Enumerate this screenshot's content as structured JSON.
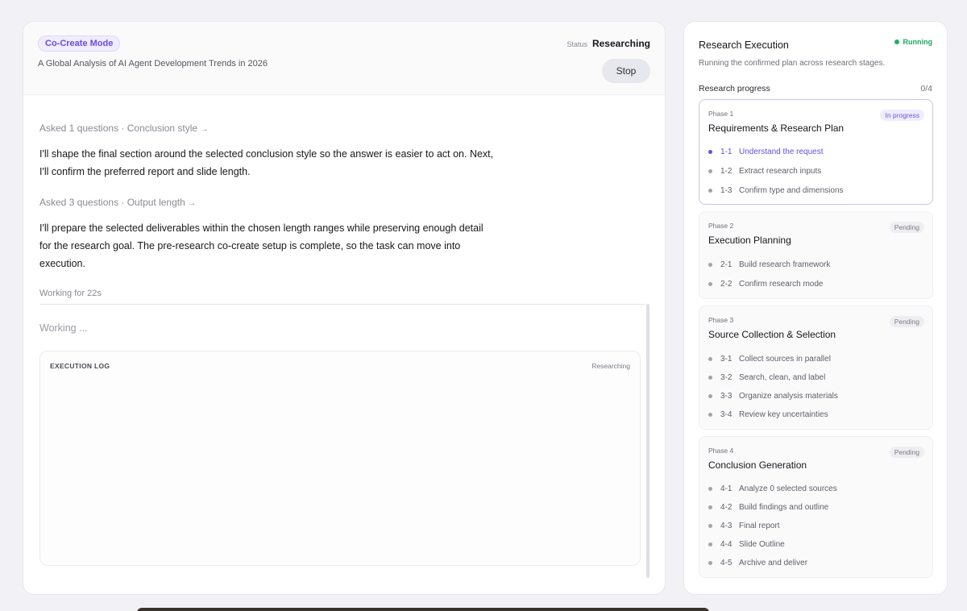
{
  "left": {
    "mode_badge": "Co-Create Mode",
    "task_title": "A Global Analysis of AI Agent Development Trends in 2026",
    "status_label": "Status",
    "status_value": "Researching",
    "stop_label": "Stop",
    "messages": [
      {
        "meta": "Asked 1 questions · Conclusion style",
        "arrow": "→",
        "lines": [
          "I'll shape the final section around the selected conclusion style so the answer is easier to act on. Next,",
          "I'll confirm the preferred report and slide length."
        ]
      },
      {
        "meta": "Asked 3 questions · Output length",
        "arrow": "→",
        "lines": [
          "I'll prepare the selected deliverables within the chosen length ranges while preserving enough detail",
          "for the research goal. The pre-research co-create setup is complete, so the task can move into",
          "execution."
        ]
      }
    ],
    "working_time": "Working for 22s",
    "working_text": "Working ...",
    "log_title": "EXECUTION LOG",
    "log_status": "Researching"
  },
  "right": {
    "title": "Research Execution",
    "running_label": "Running",
    "subtitle": "Running the confirmed plan across research stages.",
    "progress_label": "Research progress",
    "progress_count": "0/4",
    "phases": [
      {
        "num": "Phase 1",
        "name": "Requirements & Research Plan",
        "badge": "In progress",
        "steps": [
          {
            "id": "1-1",
            "label": "Understand the request"
          },
          {
            "id": "1-2",
            "label": "Extract research inputs"
          },
          {
            "id": "1-3",
            "label": "Confirm type and dimensions"
          }
        ]
      },
      {
        "num": "Phase 2",
        "name": "Execution Planning",
        "badge": "Pending",
        "steps": [
          {
            "id": "2-1",
            "label": "Build research framework"
          },
          {
            "id": "2-2",
            "label": "Confirm research mode"
          }
        ]
      },
      {
        "num": "Phase 3",
        "name": "Source Collection & Selection",
        "badge": "Pending",
        "steps": [
          {
            "id": "3-1",
            "label": "Collect sources in parallel"
          },
          {
            "id": "3-2",
            "label": "Search, clean, and label"
          },
          {
            "id": "3-3",
            "label": "Organize analysis materials"
          },
          {
            "id": "3-4",
            "label": "Review key uncertainties"
          }
        ]
      },
      {
        "num": "Phase 4",
        "name": "Conclusion Generation",
        "badge": "Pending",
        "steps": [
          {
            "id": "4-1",
            "label": "Analyze 0 selected sources"
          },
          {
            "id": "4-2",
            "label": "Build findings and outline"
          },
          {
            "id": "4-3",
            "label": "Final report"
          },
          {
            "id": "4-4",
            "label": "Slide Outline"
          },
          {
            "id": "4-5",
            "label": "Archive and deliver"
          }
        ]
      }
    ]
  },
  "colors": {
    "accent": "#6a4ce0",
    "running": "#22a564",
    "background": "#f1f1f6"
  }
}
